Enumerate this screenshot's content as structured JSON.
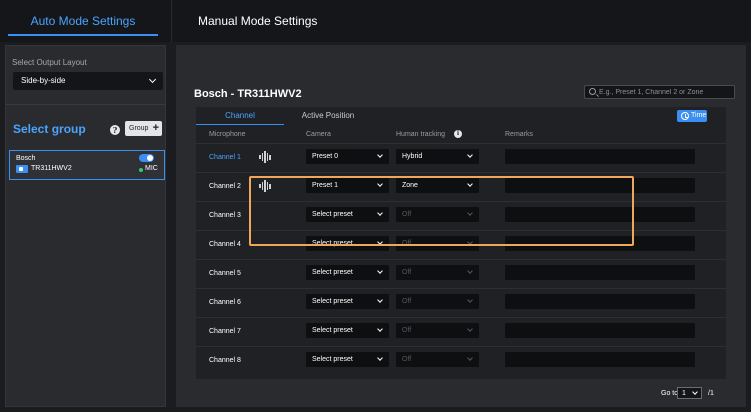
{
  "top_tabs": {
    "auto": "Auto Mode Settings",
    "manual": "Manual Mode Settings"
  },
  "sidebar": {
    "output_layout_label": "Select Output Layout",
    "output_layout_value": "Side-by-side",
    "select_group": "Select group",
    "group_button": "Group",
    "device": {
      "name": "Bosch",
      "model": "TR311HWV2",
      "mic": "MIC",
      "enabled": true
    }
  },
  "main": {
    "device_title": "Bosch - TR311HWV2",
    "search_placeholder": "E.g., Preset 1, Channel 2 or Zone",
    "tabs": {
      "channel": "Channel",
      "active_position": "Active Position"
    },
    "time_button": "Time",
    "headers": {
      "microphone": "Microphone",
      "camera": "Camera",
      "human_tracking": "Human tracking",
      "remarks": "Remarks"
    },
    "rows": [
      {
        "channel": "Channel 1",
        "camera": "Preset 0",
        "tracking": "Hybrid",
        "tracking_enabled": true,
        "has_wave": true,
        "selected": true
      },
      {
        "channel": "Channel 2",
        "camera": "Preset 1",
        "tracking": "Zone",
        "tracking_enabled": true,
        "has_wave": true,
        "selected": false
      },
      {
        "channel": "Channel 3",
        "camera": "Select preset",
        "tracking": "Off",
        "tracking_enabled": false,
        "has_wave": false,
        "selected": false
      },
      {
        "channel": "Channel 4",
        "camera": "Select preset",
        "tracking": "Off",
        "tracking_enabled": false,
        "has_wave": false,
        "selected": false
      },
      {
        "channel": "Channel 5",
        "camera": "Select preset",
        "tracking": "Off",
        "tracking_enabled": false,
        "has_wave": false,
        "selected": false
      },
      {
        "channel": "Channel 6",
        "camera": "Select preset",
        "tracking": "Off",
        "tracking_enabled": false,
        "has_wave": false,
        "selected": false
      },
      {
        "channel": "Channel 7",
        "camera": "Select preset",
        "tracking": "Off",
        "tracking_enabled": false,
        "has_wave": false,
        "selected": false
      },
      {
        "channel": "Channel 8",
        "camera": "Select preset",
        "tracking": "Off",
        "tracking_enabled": false,
        "has_wave": false,
        "selected": false
      }
    ],
    "pager": {
      "goto_label": "Go to",
      "page": "1",
      "total": "/1"
    }
  },
  "colors": {
    "accent": "#3b8ff2",
    "highlight": "#f2a65a",
    "mic_active": "#2ecc71"
  },
  "icons": [
    "chevron-down-icon",
    "info-icon",
    "plus-icon",
    "camera-device-icon",
    "search-icon",
    "clock-icon",
    "sound-wave-icon"
  ]
}
